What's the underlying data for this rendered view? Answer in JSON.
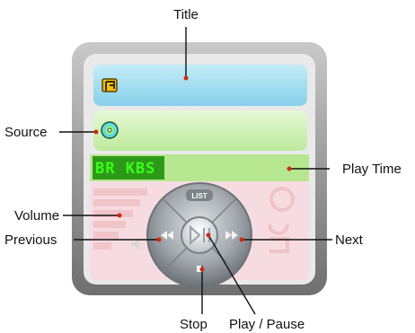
{
  "labels": {
    "title": "Title",
    "source": "Source",
    "play_time": "Play Time",
    "volume": "Volume",
    "previous": "Previous",
    "next": "Next",
    "stop": "Stop",
    "play_pause": "Play / Pause"
  },
  "player": {
    "display_text": "BR  KBS",
    "list_button": "LIST",
    "icons": {
      "title": "music-note-icon",
      "source": "cd-disc-icon",
      "previous": "rewind-icon",
      "next": "fast-forward-icon",
      "play_pause": "play-pause-icon",
      "stop": "stop-icon",
      "volume": "speaker-icon"
    },
    "colors": {
      "title_band": "#9edcf0",
      "source_band": "#c8f0a8",
      "time_band": "#b4e68e",
      "lower_band": "#f5d9dd",
      "lcd_text": "#3bff18",
      "frame": "#8a8a8a",
      "dial": "#9aa1a6"
    }
  }
}
